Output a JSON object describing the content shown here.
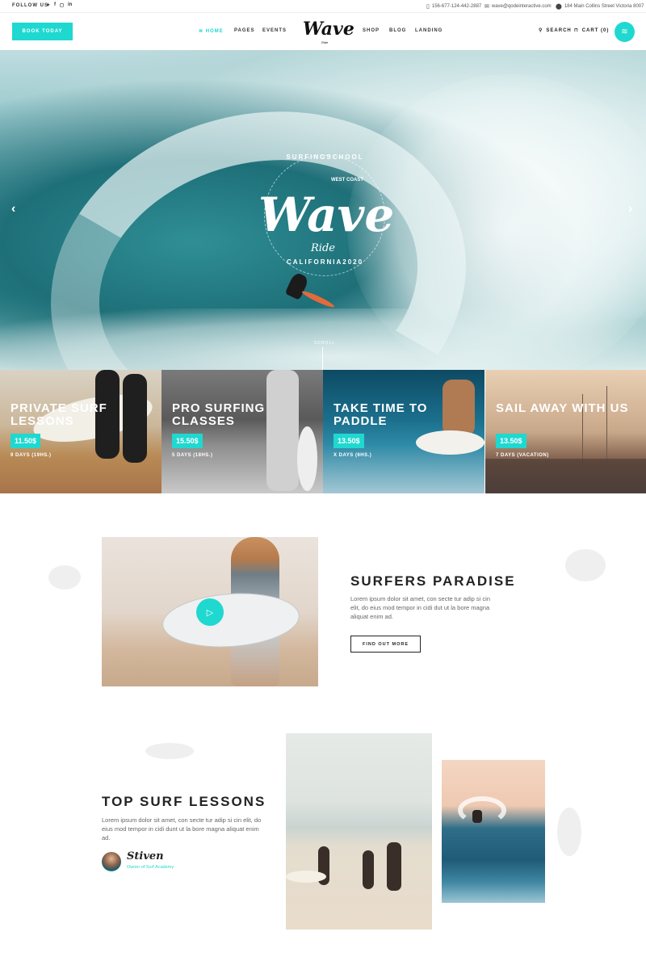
{
  "topbar": {
    "follow_label": "FOLLOW US",
    "socials": [
      "twitter-icon",
      "facebook-icon",
      "instagram-icon",
      "linkedin-icon"
    ],
    "phone": "156-677-124-442-2887",
    "email": "wave@qodeinteractive.com",
    "address": "184 Main Collins Street Victoria 8007"
  },
  "header": {
    "book_label": "BOOK TODAY",
    "nav_left": [
      "HOME",
      "PAGES",
      "EVENTS"
    ],
    "nav_right": [
      "SHOP",
      "BLOG",
      "LANDING"
    ],
    "logo": "Wave",
    "logo_sub": "Ride",
    "search_label": "SEARCH",
    "cart_label": "CART (0)"
  },
  "hero": {
    "badge_top": "SURFINGSCHOOL",
    "badge_corner": "WEST COAST",
    "logo": "Wave",
    "ride": "Ride",
    "badge_bottom": "CALIFORNIA2020",
    "scroll_label": "SCROLL"
  },
  "cards": [
    {
      "title": "PRIVATE SURF LESSONS",
      "price": "11.50$",
      "duration": "9 DAYS (19HS.)"
    },
    {
      "title": "PRO SURFING CLASSES",
      "price": "15.50$",
      "duration": "5 DAYS (18HS.)"
    },
    {
      "title": "TAKE TIME TO PADDLE",
      "price": "13.50$",
      "duration": "X DAYS (6HS.)"
    },
    {
      "title": "SAIL AWAY WITH US",
      "price": "13.50$",
      "duration": "7 DAYS (VACATION)"
    }
  ],
  "section1": {
    "title": "SURFERS PARADISE",
    "text": "Lorem ipsum dolor sit amet, con secte tur adip si cin elit, do eius mod tempor in cidi dut ut la bore magna aliquat enim ad.",
    "button": "FIND OUT MORE"
  },
  "section2": {
    "title": "TOP SURF LESSONS",
    "text": "Lorem ipsum dolor sit amet, con secte tur adip si cin elit, do eius mod tempor in cidi dunt ut la bore magna aliquat enim ad.",
    "signature": "Stiven",
    "owner": "Owner of Surf Academy"
  },
  "colors": {
    "accent": "#1fd8d0",
    "text": "#222222"
  }
}
